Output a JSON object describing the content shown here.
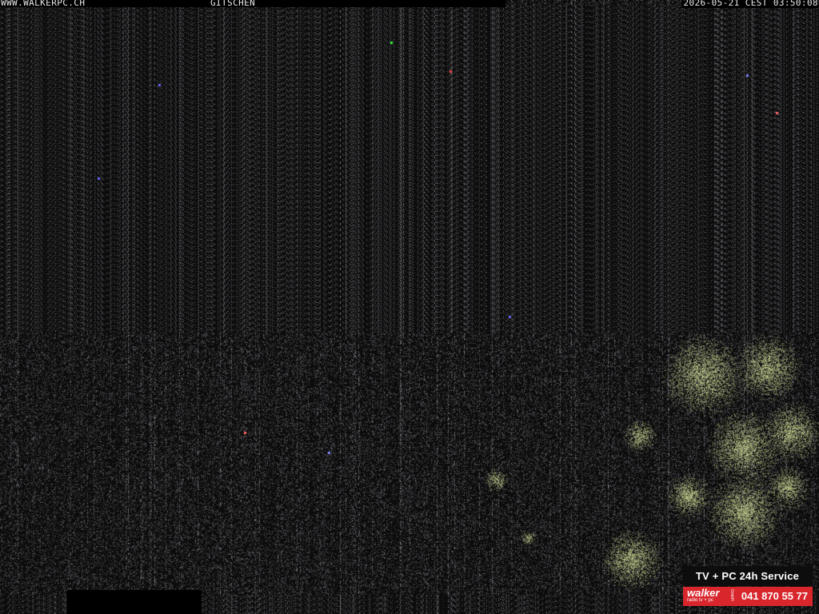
{
  "osd": {
    "site": "WWW.WALKERPC.CH",
    "location": "GITSCHEN",
    "timestamp": "2026-05-21 CEST 03:50:08"
  },
  "advert": {
    "headline": "TV + PC 24h Service",
    "brand": "walker",
    "brand_sub": "radio tv + pc",
    "brand_suffix": "GmbH",
    "phone": "041 870 55 77",
    "colors": {
      "banner": "#0d0d0d",
      "accent": "#d8262c"
    }
  },
  "scene": {
    "background": "#0b0b0b",
    "foliage": "#b9c28a"
  }
}
